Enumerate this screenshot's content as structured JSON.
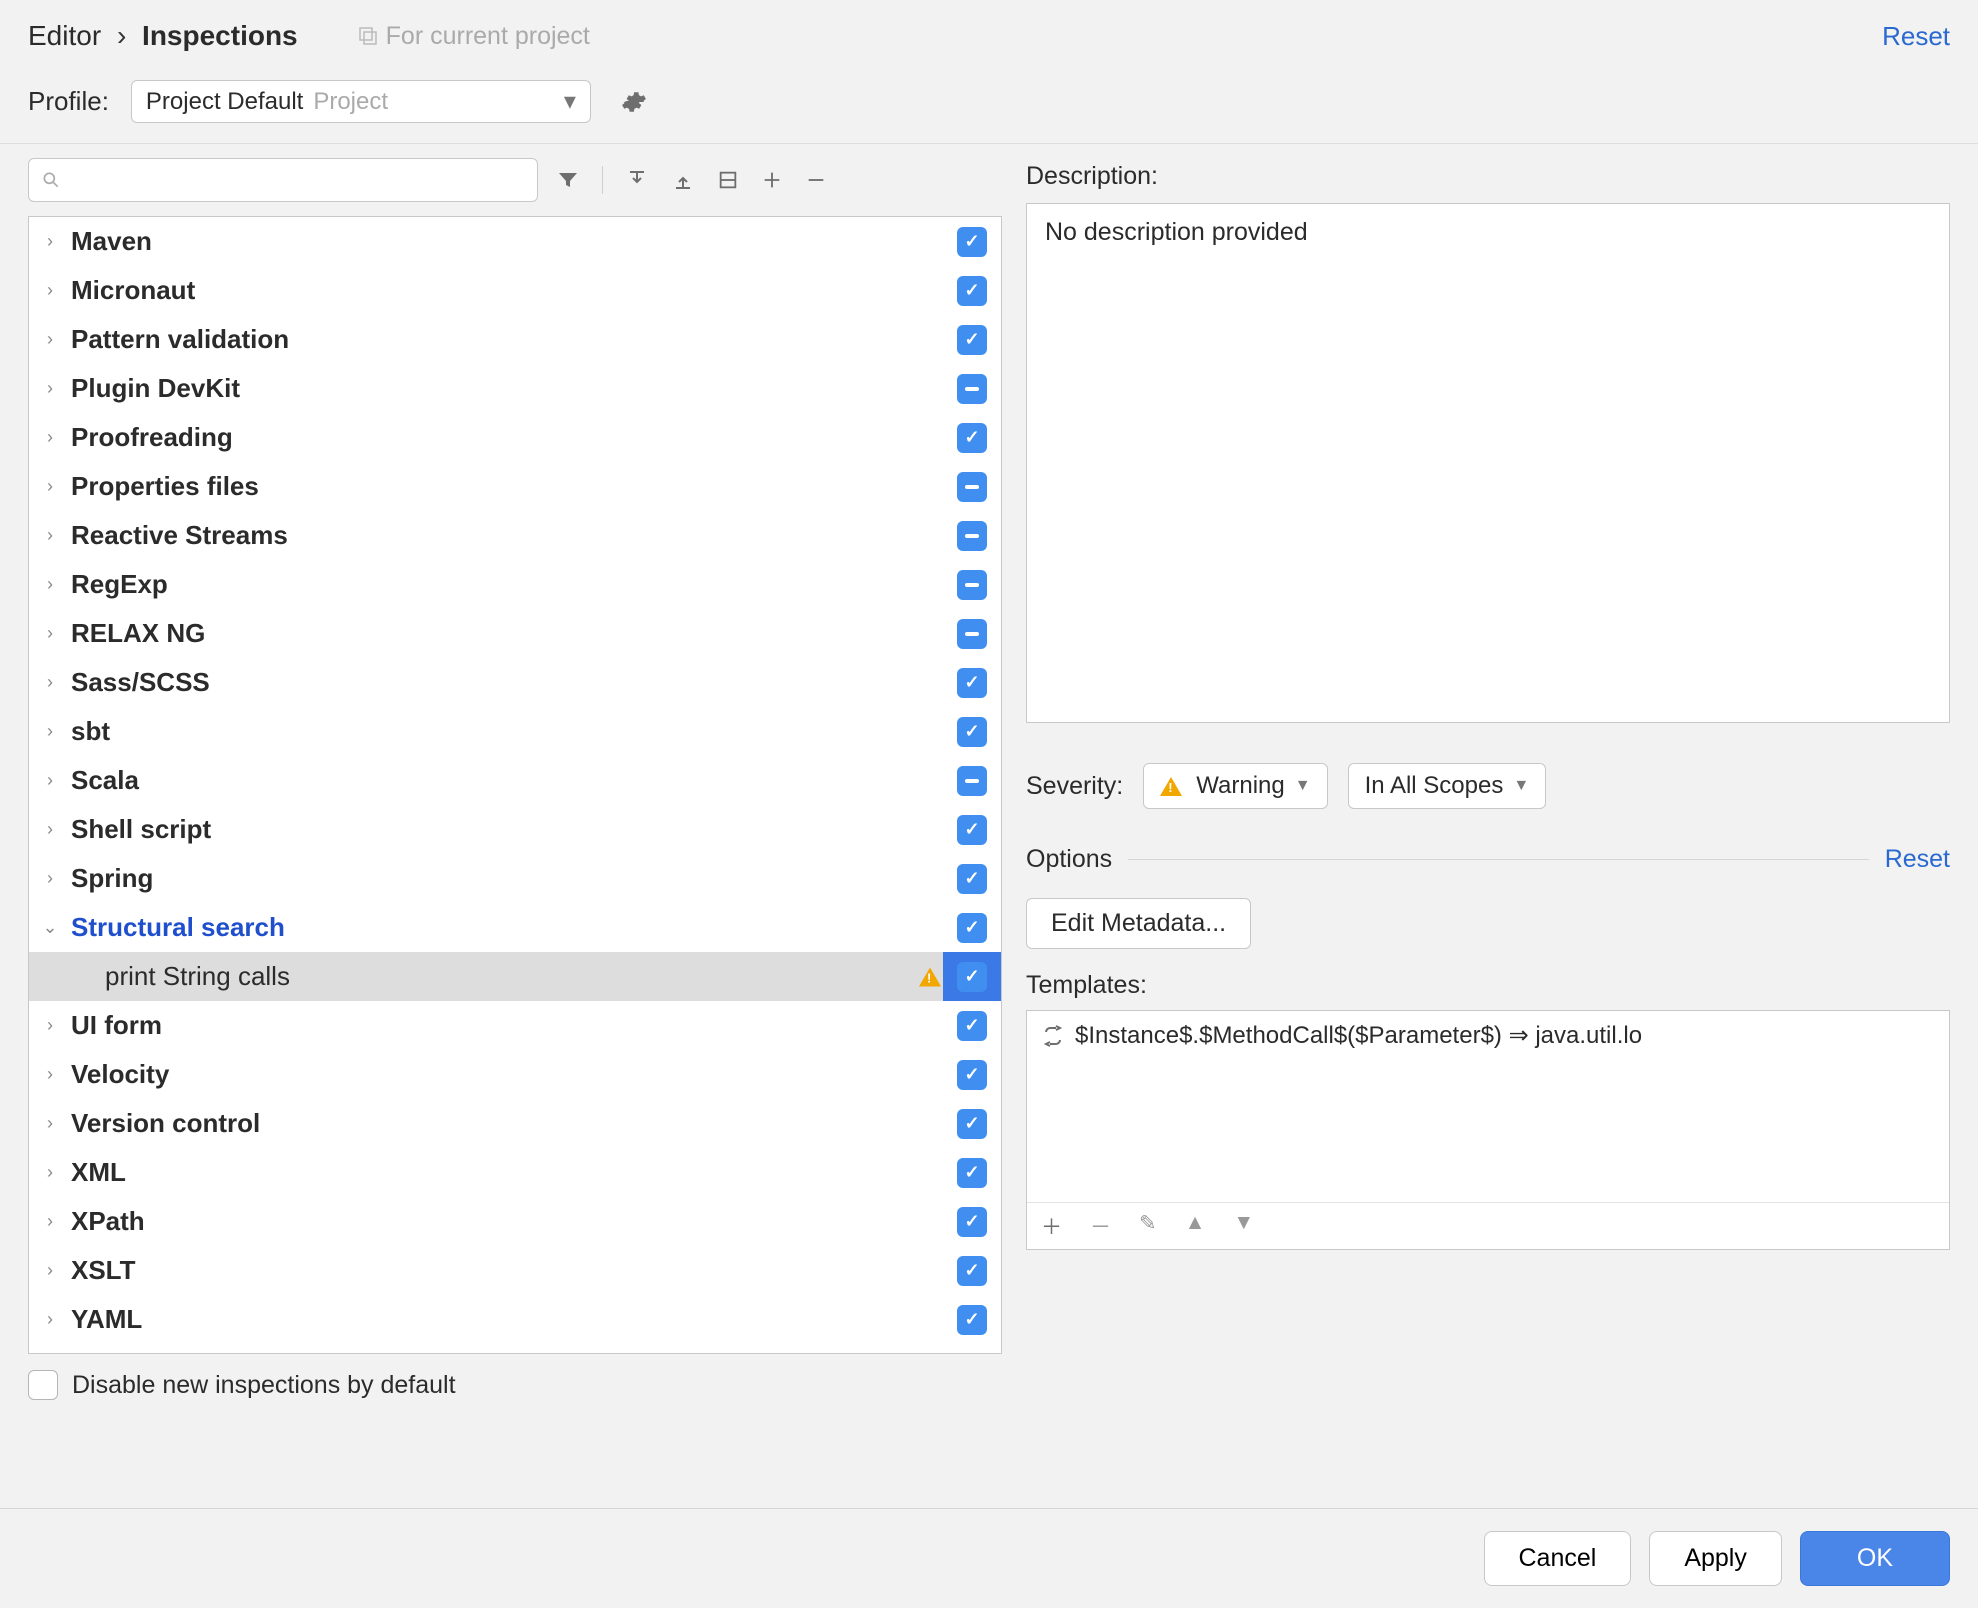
{
  "header": {
    "breadcrumb_editor": "Editor",
    "breadcrumb_sep": "›",
    "breadcrumb_inspections": "Inspections",
    "for_project": "For current project",
    "reset": "Reset"
  },
  "profile": {
    "label": "Profile:",
    "name": "Project Default",
    "scope": "Project"
  },
  "tree": [
    {
      "label": "Maven",
      "state": "checked",
      "expanded": false
    },
    {
      "label": "Micronaut",
      "state": "checked",
      "expanded": false
    },
    {
      "label": "Pattern validation",
      "state": "checked",
      "expanded": false
    },
    {
      "label": "Plugin DevKit",
      "state": "indeterminate",
      "expanded": false
    },
    {
      "label": "Proofreading",
      "state": "checked",
      "expanded": false
    },
    {
      "label": "Properties files",
      "state": "indeterminate",
      "expanded": false
    },
    {
      "label": "Reactive Streams",
      "state": "indeterminate",
      "expanded": false
    },
    {
      "label": "RegExp",
      "state": "indeterminate",
      "expanded": false
    },
    {
      "label": "RELAX NG",
      "state": "indeterminate",
      "expanded": false
    },
    {
      "label": "Sass/SCSS",
      "state": "checked",
      "expanded": false
    },
    {
      "label": "sbt",
      "state": "checked",
      "expanded": false
    },
    {
      "label": "Scala",
      "state": "indeterminate",
      "expanded": false
    },
    {
      "label": "Shell script",
      "state": "checked",
      "expanded": false
    },
    {
      "label": "Spring",
      "state": "checked",
      "expanded": false
    },
    {
      "label": "Structural search",
      "state": "checked",
      "expanded": true,
      "highlighted": true
    },
    {
      "label": "print String calls",
      "state": "checked",
      "child": true,
      "selected": true,
      "warning": true
    },
    {
      "label": "UI form",
      "state": "checked",
      "expanded": false
    },
    {
      "label": "Velocity",
      "state": "checked",
      "expanded": false
    },
    {
      "label": "Version control",
      "state": "checked",
      "expanded": false
    },
    {
      "label": "XML",
      "state": "checked",
      "expanded": false
    },
    {
      "label": "XPath",
      "state": "checked",
      "expanded": false
    },
    {
      "label": "XSLT",
      "state": "checked",
      "expanded": false
    },
    {
      "label": "YAML",
      "state": "checked",
      "expanded": false
    }
  ],
  "disable_label": "Disable new inspections by default",
  "right": {
    "desc_label": "Description:",
    "desc_text": "No description provided",
    "severity_label": "Severity:",
    "severity_value": "Warning",
    "scope_value": "In All Scopes",
    "options_label": "Options",
    "options_reset": "Reset",
    "edit_metadata": "Edit Metadata...",
    "templates_label": "Templates:",
    "template_row": "$Instance$.$MethodCall$($Parameter$) ⇒ java.util.lo"
  },
  "buttons": {
    "cancel": "Cancel",
    "apply": "Apply",
    "ok": "OK"
  }
}
